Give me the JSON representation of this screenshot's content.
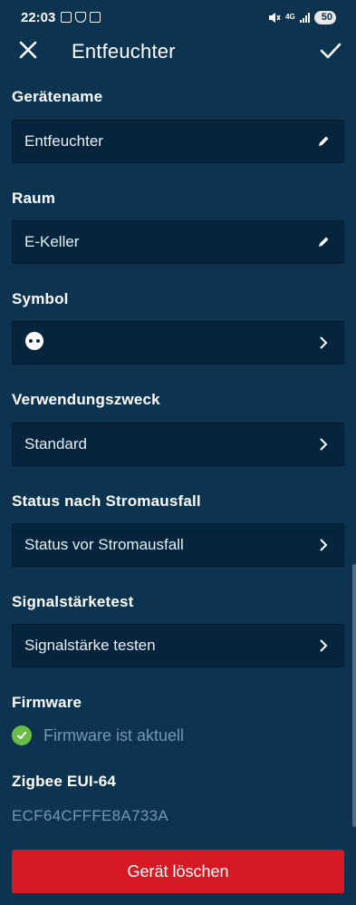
{
  "status_bar": {
    "time": "22:03",
    "network": "4G",
    "battery": "50"
  },
  "header": {
    "title": "Entfeuchter"
  },
  "fields": {
    "device_name": {
      "label": "Gerätename",
      "value": "Entfeuchter",
      "icon": "pencil-icon"
    },
    "room": {
      "label": "Raum",
      "value": "E-Keller",
      "icon": "pencil-icon"
    },
    "symbol": {
      "label": "Symbol",
      "icon": "plug-icon"
    },
    "purpose": {
      "label": "Verwendungszweck",
      "value": "Standard"
    },
    "power_status": {
      "label": "Status nach Stromausfall",
      "value": "Status vor Stromausfall"
    },
    "signal_test": {
      "label": "Signalstärketest",
      "value": "Signalstärke testen"
    }
  },
  "firmware": {
    "label": "Firmware",
    "status": "Firmware ist aktuell",
    "status_color": "#6cbd45"
  },
  "zigbee": {
    "label": "Zigbee EUI-64",
    "value": "ECF64CFFFE8A733A"
  },
  "delete_button": {
    "label": "Gerät löschen",
    "color": "#d61a25"
  },
  "colors": {
    "background": "#0c3350",
    "field": "#06253d"
  }
}
